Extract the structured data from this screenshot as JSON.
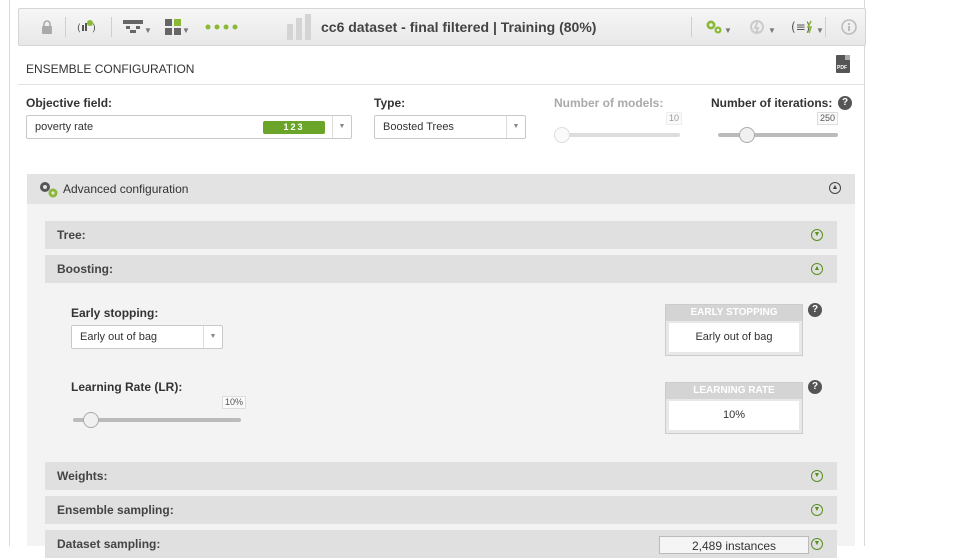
{
  "toolbar": {
    "title": "cc6 dataset - final filtered | Training (80%)"
  },
  "section": {
    "title": "ENSEMBLE CONFIGURATION",
    "pdf_label": "PDF"
  },
  "objective": {
    "label": "Objective field:",
    "value": "poverty rate",
    "type_badge": "123"
  },
  "type": {
    "label": "Type:",
    "value": "Boosted Trees"
  },
  "num_models": {
    "label": "Number of models:",
    "value": "10"
  },
  "num_iterations": {
    "label": "Number of iterations:",
    "value": "250",
    "help": "?"
  },
  "advanced": {
    "title": "Advanced configuration",
    "tree": {
      "label": "Tree:"
    },
    "boosting": {
      "label": "Boosting:",
      "early_stopping": {
        "label": "Early stopping:",
        "value": "Early out of bag",
        "box_title": "EARLY STOPPING",
        "box_value": "Early out of bag",
        "help": "?"
      },
      "learning_rate": {
        "label": "Learning Rate (LR):",
        "value": "10%",
        "box_title": "LEARNING RATE",
        "box_value": "10%",
        "help": "?"
      }
    },
    "weights": {
      "label": "Weights:"
    },
    "ensemble_sampling": {
      "label": "Ensemble sampling:"
    },
    "dataset_sampling": {
      "label": "Dataset sampling:",
      "instances": "2,489 instances"
    }
  },
  "colors": {
    "accent_green": "#6aa52a",
    "icon_green": "#8ab936"
  }
}
